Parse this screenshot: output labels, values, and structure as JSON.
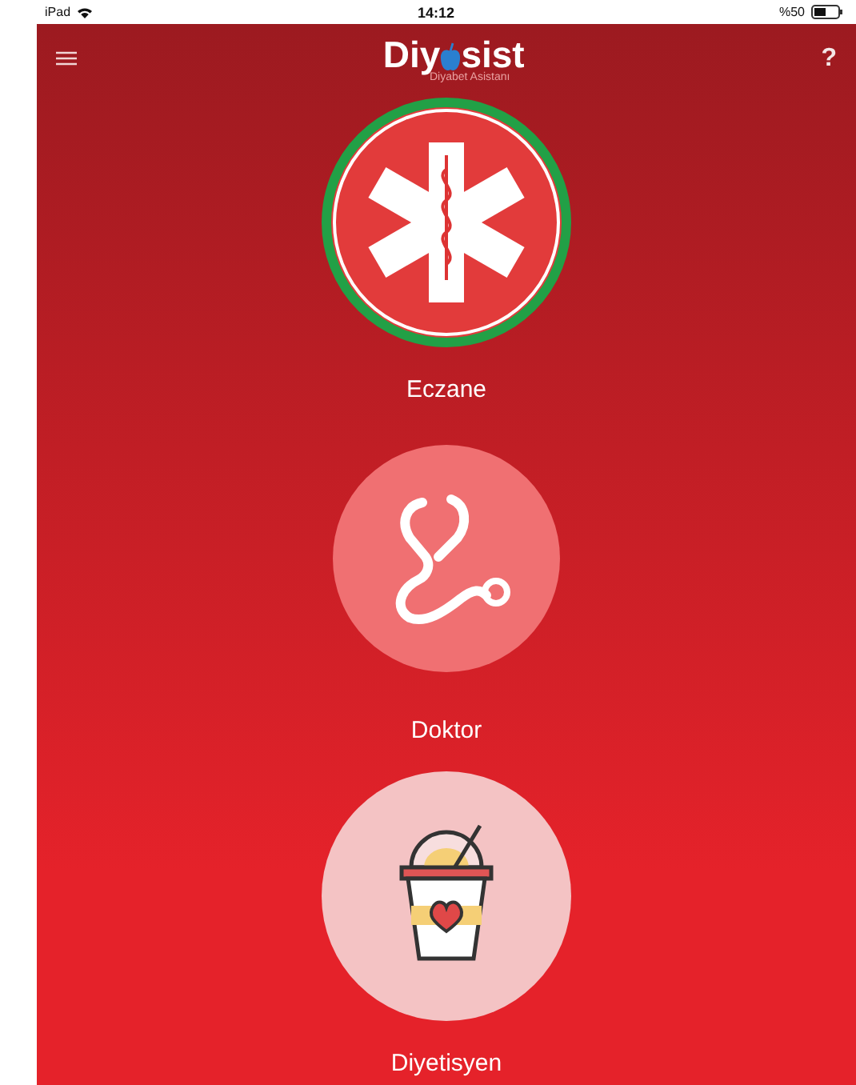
{
  "status_bar": {
    "device": "iPad",
    "time": "14:12",
    "battery": "%50"
  },
  "header": {
    "logo_start": "Diy",
    "logo_end": "sist",
    "subtitle": "Diyabet Asistanı",
    "help": "?"
  },
  "items": [
    {
      "kind": "star-of-life",
      "label": "Eczane"
    },
    {
      "kind": "stethoscope",
      "label": "Doktor"
    },
    {
      "kind": "cup",
      "label": "Diyetisyen"
    }
  ]
}
